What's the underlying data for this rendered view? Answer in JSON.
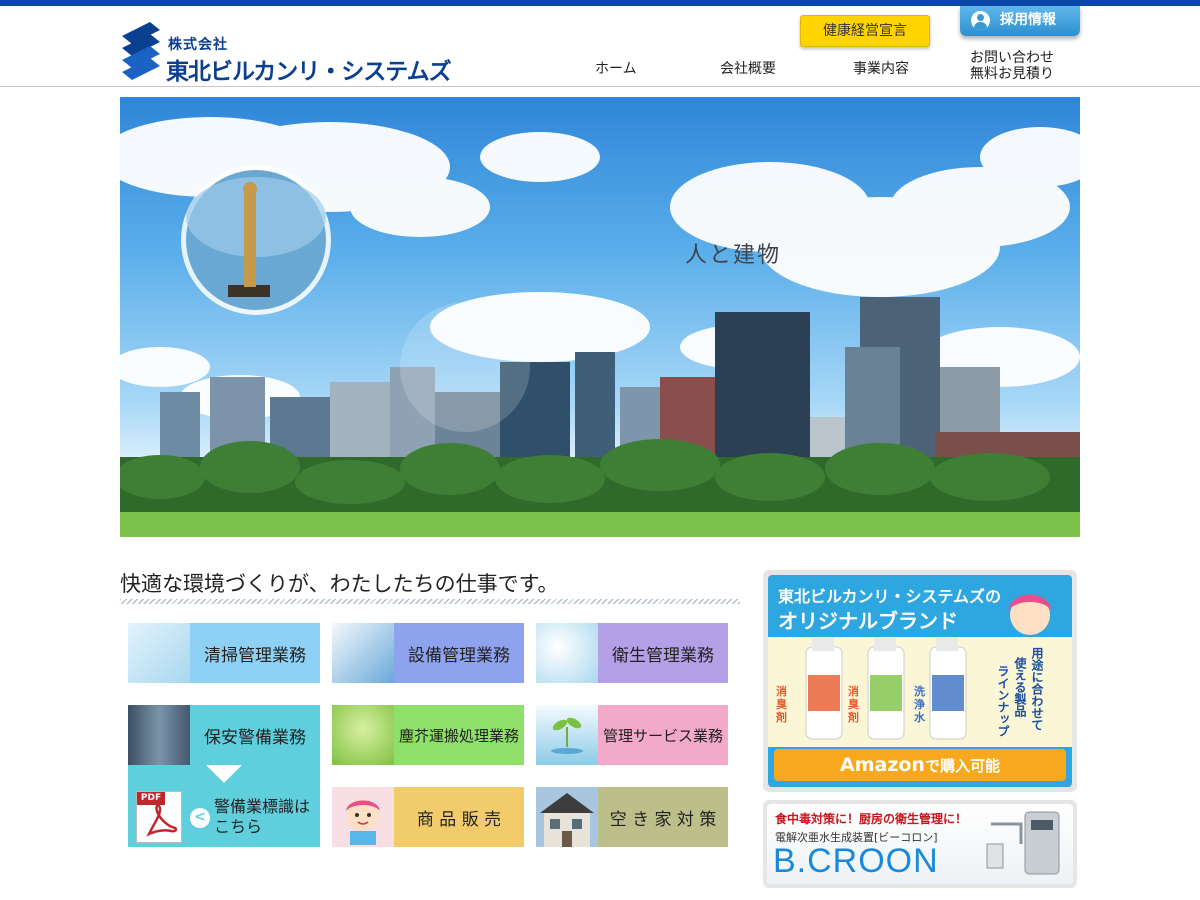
{
  "header": {
    "logo_small": "株式会社",
    "logo_big": "東北ビルカンリ・システムズ",
    "health_button": "健康経営宣言",
    "recruit_button": "採用情報",
    "nav": [
      "ホーム",
      "会社概要",
      "事業内容"
    ],
    "contact_line1": "お問い合わせ",
    "contact_line2": "無料お見積り"
  },
  "hero": {
    "title": "人と建物"
  },
  "main": {
    "tagline": "快適な環境づくりが、わたしたちの仕事です。",
    "services": [
      {
        "label": "清掃管理業務",
        "color": "#8fd1f4"
      },
      {
        "label": "設備管理業務",
        "color": "#8ea3ee"
      },
      {
        "label": "衛生管理業務",
        "color": "#b4a0e6"
      },
      {
        "label": "保安警備業務",
        "color": "#5fcfdd"
      },
      {
        "label": "塵芥運搬処理業務",
        "color": "#8ee06a"
      },
      {
        "label": "管理サービス業務",
        "color": "#f3a9c9"
      },
      {
        "label": "商 品 販 売",
        "color": "#f2cc6a"
      },
      {
        "label": "空 き 家 対 策",
        "color": "#bdbf8a"
      }
    ],
    "guard_sign_line1": "警備業標識は",
    "guard_sign_line2": "こちら",
    "pdf_label": "PDF"
  },
  "sidebar": {
    "brand_line1": "東北ビルカンリ・システムズの",
    "brand_line2": "オリジナルブランド",
    "lineup_text1": "用途に合わせて",
    "lineup_text2": "使える製品",
    "lineup_text3": "ラインナップ",
    "tag1": "消臭剤",
    "tag2": "消臭剤",
    "tag3": "洗浄水",
    "amazon_word": "Amazon",
    "amazon_rest": "で購入可能",
    "bcroon_top": "食中毒対策に！厨房の衛生管理に！",
    "bcroon_sub": "電解次亜水生成装置[ビーコロン]",
    "bcroon_logo": "B.CROON"
  },
  "colors": {
    "brand_blue": "#0b3f8f",
    "top_bar": "#0a47a8",
    "health_yellow": "#ffd400",
    "recruit_blue": "#2d8fd0"
  }
}
